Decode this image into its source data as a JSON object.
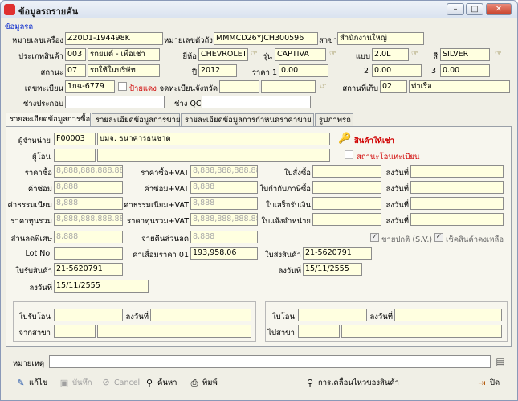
{
  "window": {
    "title": "ข้อมูลรถรายคัน",
    "min": "–",
    "max": "□",
    "close": "✕"
  },
  "section_title": "ข้อมูลรถ",
  "header": {
    "chassis_label": "หมายเลขเครื่อง",
    "chassis": "Z20D1-194498K",
    "body_label": "หมายเลขตัวถัง",
    "body": "MMMCD26YJCH300596",
    "branch_label": "สาขา",
    "branch": "สำนักงานใหญ่",
    "ptype_label": "ประเภทสินค้า",
    "ptype_code": "003",
    "ptype_name": "รถยนต์ - เพื่อเช่า",
    "brand_label": "ยี่ห้อ",
    "brand": "CHEVROLET",
    "model_label": "รุ่น",
    "model": "CAPTIVA",
    "variant_label": "แบบ",
    "variant": "2.0L",
    "color_label": "สี",
    "color": "SILVER",
    "status_label": "สถานะ",
    "status_code": "07",
    "status_name": "รถใช้ในบริษัท",
    "year_label": "ปี",
    "year": "2012",
    "price1_label": "ราคา 1",
    "price1": "0.00",
    "price2_label": "2",
    "price2": "0.00",
    "price3_label": "3",
    "price3": "0.00",
    "plate_label": "เลขทะเบียน",
    "plate": "1กฉ-6779",
    "redplate_label": "ป้ายแดง",
    "province_label": "จดทะเบียนจังหวัด",
    "province": "",
    "location_label": "สถานที่เก็บ",
    "location_code": "02",
    "location_name": "ท่าเรือ",
    "assembler_label": "ช่างประกอบ",
    "assembler": "",
    "qc_label": "ช่าง QC",
    "qc": ""
  },
  "tabs": [
    "รายละเอียดข้อมูลการซื้อ",
    "รายละเอียดข้อมูลการขาย",
    "รายละเอียดข้อมูลการกำหนดราคาขาย",
    "รูปภาพรถ"
  ],
  "purchase": {
    "vendor_label": "ผู้จำหน่าย",
    "vendor_code": "F00003",
    "vendor_name": "บมจ. ธนาคารธนชาต",
    "transferor_label": "ผู้โอน",
    "transferor_code": "",
    "transferor_name": "",
    "rental_badge": "สินค้าให้เช่า",
    "transfer_status": "สถานะโอนทะเบียน",
    "buy_price_label": "ราคาซื้อ",
    "buy_price": "8,888,888,888.88",
    "buy_vat_label": "ราคาซื้อ+VAT",
    "buy_vat": "8,888,888,888.88",
    "po_label": "ใบสั่งซื้อ",
    "po": "",
    "po_date_label": "ลงวันที่",
    "po_date": "",
    "repair_label": "ค่าซ่อม",
    "repair": "8,888",
    "repair_vat_label": "ค่าซ่อม+VAT",
    "repair_vat": "8,888",
    "taxinv_label": "ใบกำกับภาษีซื้อ",
    "taxinv": "",
    "taxinv_date_label": "ลงวันที่",
    "taxinv_date": "",
    "fee_label": "ค่าธรรมเนียม",
    "fee": "8,888",
    "fee_vat_label": "ค่าธรรมเนียม+VAT",
    "fee_vat": "8,888",
    "receipt_label": "ใบเสร็จรับเงิน",
    "receipt": "",
    "receipt_date_label": "ลงวันที่",
    "receipt_date": "",
    "total_label": "ราคาทุนรวม",
    "total": "8,888,888,888.88",
    "total_vat_label": "ราคาทุนรวม+VAT",
    "total_vat": "8,888,888,888.88",
    "debit_label": "ใบแจ้งจำหน่าย",
    "debit": "",
    "debit_date_label": "ลงวันที่",
    "debit_date": "",
    "discount_label": "ส่วนลดพิเศษ",
    "discount": "8,888",
    "paydisc_label": "จ่ายคืนส่วนลด",
    "paydisc": "8,888",
    "sv_label": "ขายปกติ (S.V.)",
    "stock_label": "เช็คสินค้าคงเหลือ",
    "lot_label": "Lot No.",
    "lot": "",
    "depr_label": "ค่าเสื่อมราคา 01",
    "depr": "193,958.06",
    "delivery_label": "ใบส่งสินค้า",
    "delivery": "21-5620791",
    "delivery_date_label": "ลงวันที่",
    "delivery_date": "15/11/2555",
    "gr_label": "ใบรับสินค้า",
    "gr": "21-5620791",
    "gr_date_label": "ลงวันที่",
    "gr_date": "15/11/2555",
    "tin_label": "ใบรับโอน",
    "tin": "",
    "tin_date_label": "ลงวันที่",
    "tin_date": "",
    "from_label": "จากสาขา",
    "from_code": "",
    "from_name": "",
    "tout_label": "ใบโอน",
    "tout": "",
    "tout_date_label": "ลงวันที่",
    "tout_date": "",
    "to_label": "ไปสาขา",
    "to_code": "",
    "to_name": ""
  },
  "remark_label": "หมายเหตุ",
  "remark": "",
  "toolbar": {
    "edit": "แก้ไข",
    "save": "บันทึก",
    "cancel": "Cancel",
    "search": "ค้นหา",
    "print": "พิมพ์",
    "movement": "การเคลื่อนไหวของสินค้า",
    "close": "ปิด"
  }
}
